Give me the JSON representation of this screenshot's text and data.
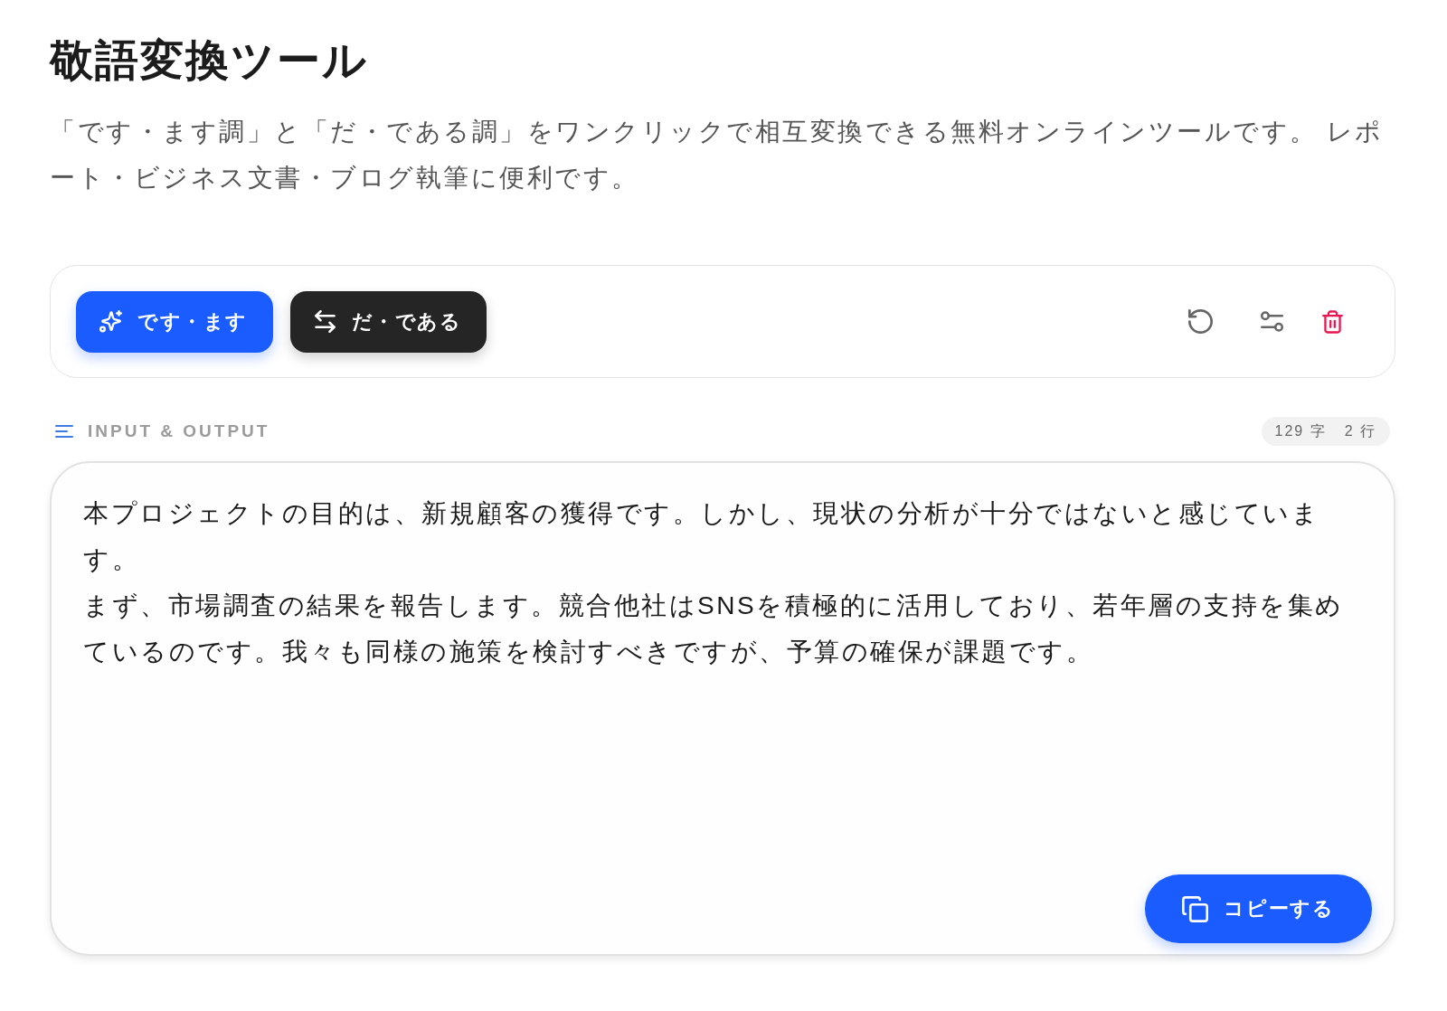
{
  "header": {
    "title": "敬語変換ツール",
    "description": "「です・ます調」と「だ・である調」をワンクリックで相互変換できる無料オンラインツールです。 レポート・ビジネス文書・ブログ執筆に便利です。"
  },
  "toolbar": {
    "modes": [
      {
        "label": "です・ます",
        "kind": "polite"
      },
      {
        "label": "だ・である",
        "kind": "plain"
      }
    ]
  },
  "section": {
    "label": "INPUT & OUTPUT",
    "counts": [
      "129 字",
      "2 行"
    ]
  },
  "editor": {
    "paragraphs": [
      "本プロジェクトの目的は、新規顧客の獲得です。しかし、現状の分析が十分ではないと感じています。",
      "まず、市場調査の結果を報告します。競合他社はSNSを積極的に活用しており、若年層の支持を集めているのです。我々も同様の施策を検討すべきですが、予算の確保が課題です。"
    ],
    "copy_button": "コピーする"
  }
}
